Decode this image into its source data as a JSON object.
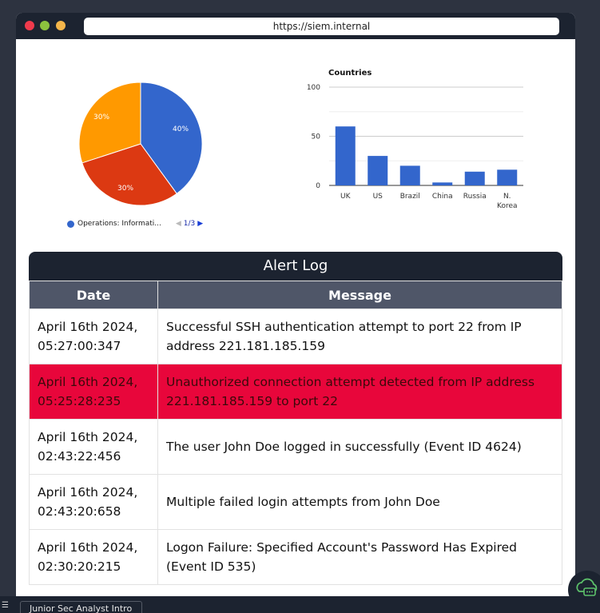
{
  "browser": {
    "url": "https://siem.internal"
  },
  "pie": {
    "slices": [
      {
        "label": "40%",
        "value": 40,
        "color": "#3366cc"
      },
      {
        "label": "30%",
        "value": 30,
        "color": "#dc3912"
      },
      {
        "label": "30%",
        "value": 30,
        "color": "#ff9900"
      }
    ],
    "legend_text": "Operations: Informati...",
    "pager": "1/3"
  },
  "chart_data": {
    "type": "bar",
    "title": "Countries",
    "categories": [
      "UK",
      "US",
      "Brazil",
      "China",
      "Russia",
      "N. Korea"
    ],
    "values": [
      60,
      30,
      20,
      3,
      14,
      16
    ],
    "ylim": [
      0,
      100
    ],
    "yticks": [
      0,
      50,
      100
    ],
    "color": "#3366cc",
    "grid": true
  },
  "alert_log": {
    "title": "Alert Log",
    "headers": [
      "Date",
      "Message"
    ],
    "rows": [
      {
        "date_line1": "April 16th 2024,",
        "date_line2": "05:27:00:347",
        "message": "Successful SSH authentication attempt to port 22 from IP address 221.181.185.159",
        "critical": false
      },
      {
        "date_line1": "April 16th 2024,",
        "date_line2": "05:25:28:235",
        "message": "Unauthorized connection attempt detected from IP address 221.181.185.159 to port 22",
        "critical": true
      },
      {
        "date_line1": "April 16th 2024,",
        "date_line2": "02:43:22:456",
        "message": "The user John Doe logged in successfully (Event ID 4624)",
        "critical": false
      },
      {
        "date_line1": "April 16th 2024,",
        "date_line2": "02:43:20:658",
        "message": "Multiple failed login attempts from John Doe",
        "critical": false
      },
      {
        "date_line1": "April 16th 2024,",
        "date_line2": "02:30:20:215",
        "message": "Logon Failure: Specified Account's Password Has Expired (Event ID 535)",
        "critical": false
      }
    ]
  },
  "taskbar": {
    "tab_label": "Junior Sec Analyst Intro"
  }
}
